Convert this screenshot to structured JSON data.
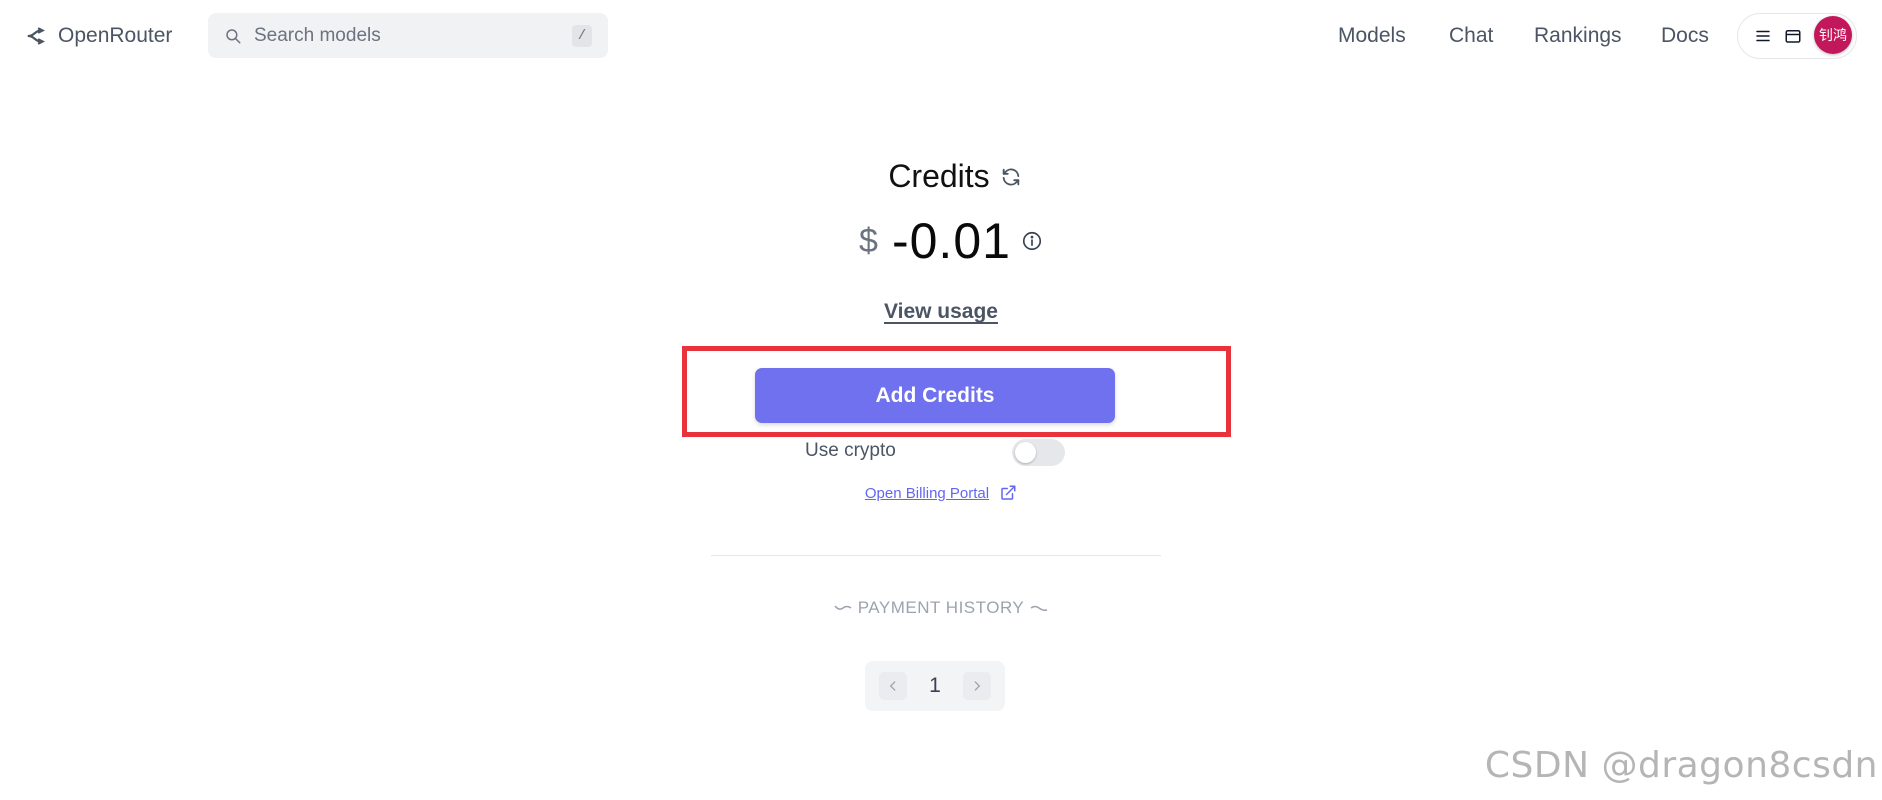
{
  "header": {
    "brand_name": "OpenRouter",
    "brand_icon": "openrouter-logo-icon",
    "search_placeholder": "Search models",
    "search_shortcut": "/",
    "nav": [
      "Models",
      "Chat",
      "Rankings",
      "Docs"
    ],
    "menu_icons": [
      "hamburger-menu-icon",
      "wallet-icon"
    ],
    "avatar_text": "钊鸿",
    "avatar_color": "#c2185b"
  },
  "credits": {
    "title": "Credits",
    "currency_symbol": "$",
    "balance": "-0.01",
    "view_usage": "View usage",
    "add_credits": "Add Credits",
    "use_crypto_label": "Use crypto",
    "use_crypto_enabled": false,
    "billing_portal": "Open Billing Portal"
  },
  "payment_history": {
    "title": "PAYMENT HISTORY",
    "current_page": "1"
  },
  "watermark": "CSDN @dragon8csdn",
  "colors": {
    "accent": "#6f71ee",
    "highlight": "#e8333c",
    "link": "#6366f1"
  }
}
